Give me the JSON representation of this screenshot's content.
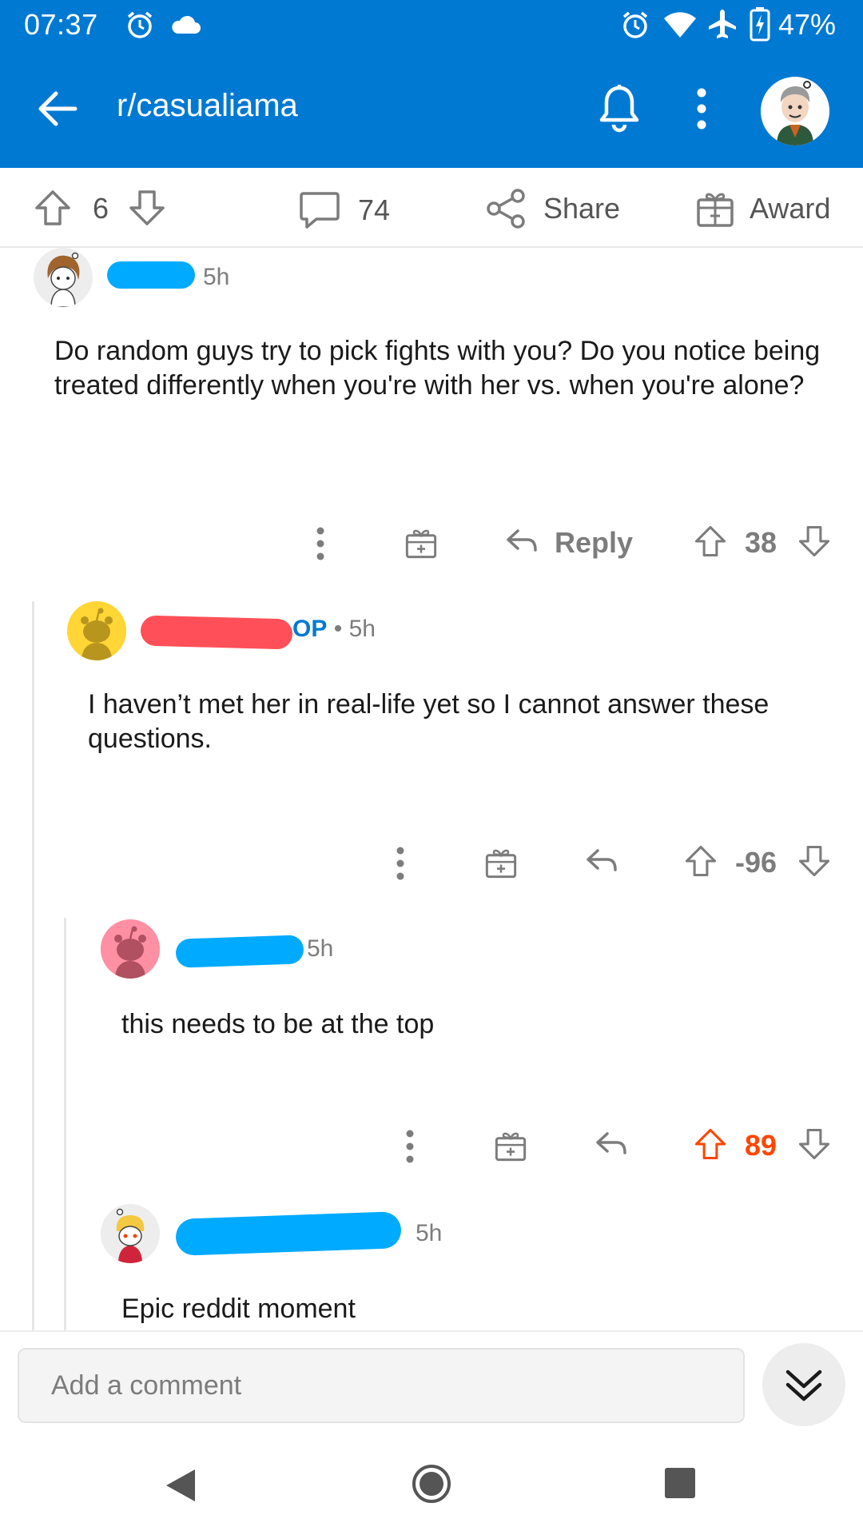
{
  "status": {
    "time": "07:37",
    "battery": "47%",
    "icons": [
      "alarm-icon",
      "cloud-icon",
      "alarm-icon",
      "wifi-icon",
      "airplane-icon",
      "battery-icon"
    ]
  },
  "appbar": {
    "title": "r/casualiama",
    "icons": [
      "back-arrow-icon",
      "bell-icon",
      "more-vertical-icon",
      "user-avatar"
    ]
  },
  "post_actions": {
    "vote_count": "6",
    "comment_count": "74",
    "share_label": "Share",
    "award_label": "Award"
  },
  "comments": [
    {
      "time": "5h",
      "text": "Do random guys try to pick fights with you? Do you notice being treated differently when you're with her vs. when you're alone?",
      "reply_label": "Reply",
      "score": "38"
    },
    {
      "op_tag": "OP",
      "separator": "•",
      "time": "5h",
      "text": "I haven’t met her in real-life yet so I cannot answer these questions.",
      "score": "-96"
    },
    {
      "time": "5h",
      "text": "this needs to be at the top",
      "score": "89"
    },
    {
      "time": "5h",
      "text": "Epic reddit moment"
    }
  ],
  "composer": {
    "placeholder": "Add a comment"
  },
  "colors": {
    "brand_blue": "#0079d3",
    "upvote_orange": "#ff4500",
    "redaction_blue": "#00aaff",
    "redaction_red": "#ff4f58",
    "text_gray": "#7c7c7c"
  }
}
